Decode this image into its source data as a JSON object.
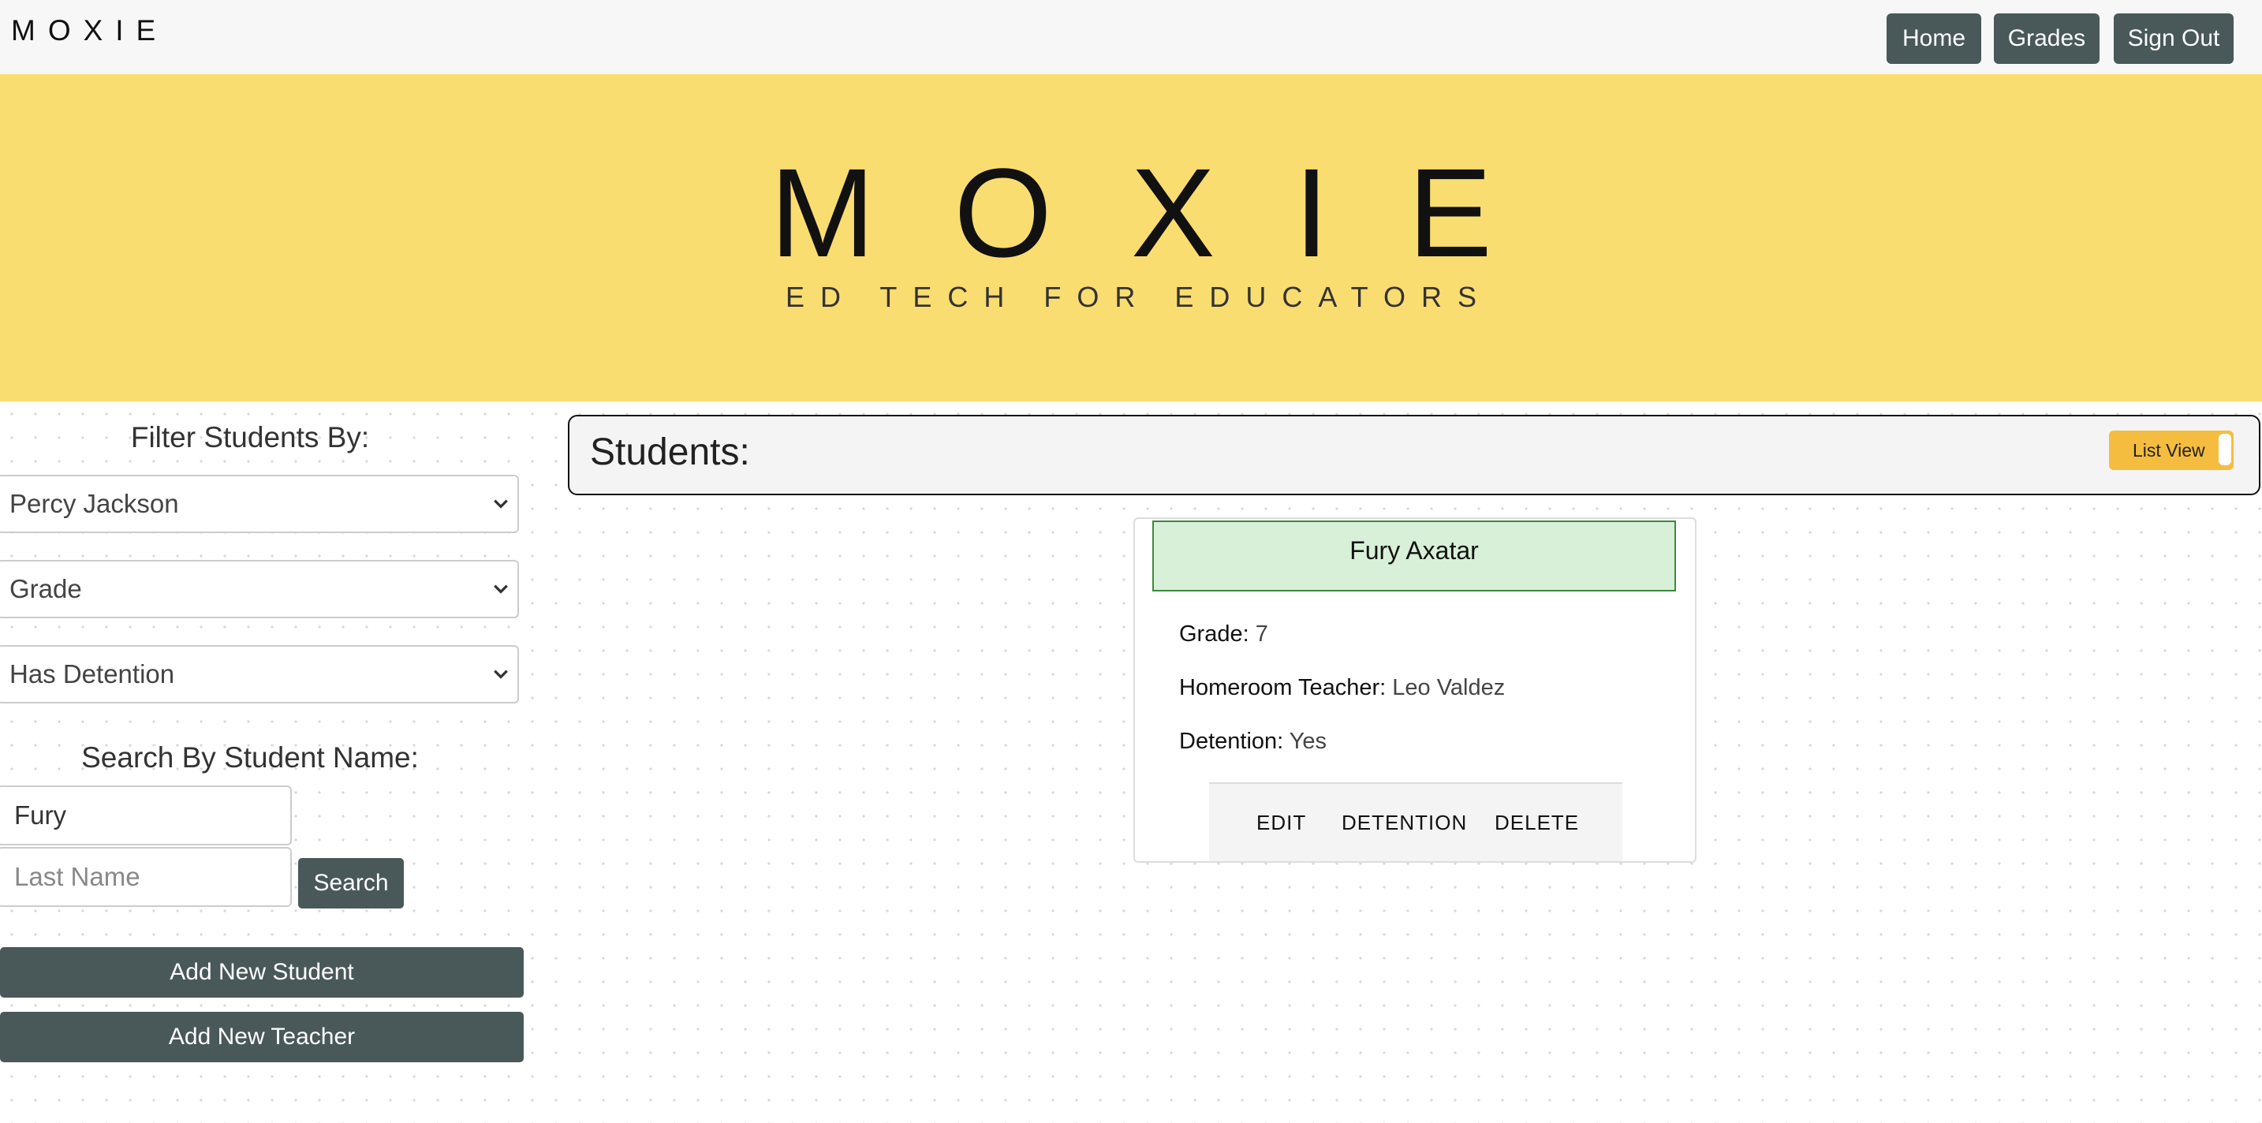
{
  "navbar": {
    "brand": "MOXIE",
    "buttons": {
      "home": "Home",
      "grades": "Grades",
      "sign_out": "Sign Out"
    }
  },
  "hero": {
    "logo": "MOXIE",
    "tagline": "ED TECH FOR EDUCATORS"
  },
  "sidebar": {
    "filter_title": "Filter Students By:",
    "filters": {
      "teacher": "Percy Jackson",
      "grade": "Grade",
      "detention": "Has Detention"
    },
    "search_title": "Search By Student Name:",
    "first_name_value": "Fury",
    "last_name_placeholder": "Last Name",
    "search_label": "Search",
    "add_student_label": "Add New Student",
    "add_teacher_label": "Add New Teacher"
  },
  "students": {
    "title": "Students:",
    "view_toggle_label": "List View",
    "cards": [
      {
        "name": "Fury Axatar",
        "grade_label": "Grade:",
        "grade": "7",
        "homeroom_label": "Homeroom Teacher:",
        "homeroom": "Leo Valdez",
        "detention_label": "Detention:",
        "detention": "Yes",
        "actions": {
          "edit": "EDIT",
          "detention": "DETENTION",
          "delete": "DELETE"
        }
      }
    ]
  },
  "colors": {
    "accent_dark": "#495859",
    "hero_yellow": "#fadd70",
    "toggle_yellow": "#f5bd3f",
    "card_header_green": "#d8f0d8"
  }
}
